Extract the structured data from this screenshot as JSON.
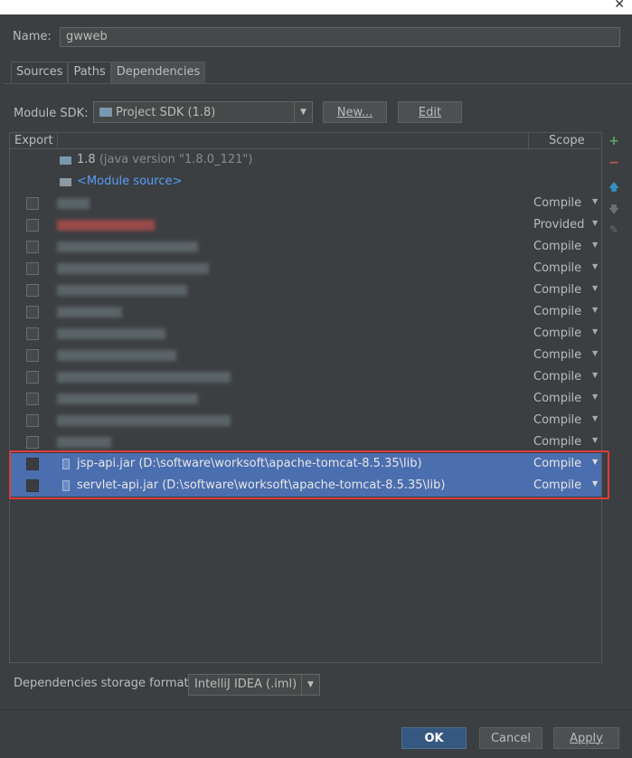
{
  "window": {
    "close_glyph": "✕"
  },
  "name": {
    "label": "Name:",
    "value": "gwweb"
  },
  "tabs": [
    {
      "label": "Sources"
    },
    {
      "label": "Paths"
    },
    {
      "label": "Dependencies",
      "active": true
    }
  ],
  "module_sdk": {
    "label": "Module SDK:",
    "value": "Project SDK (1.8)",
    "new_label": "New...",
    "edit_label": "Edit"
  },
  "table": {
    "col_export": "Export",
    "col_scope": "Scope",
    "sdk_entry": {
      "name": "1.8",
      "detail": "(java version \"1.8.0_121\")"
    },
    "module_source": "<Module source>",
    "rows": [
      {
        "scope": "Compile"
      },
      {
        "scope": "Provided"
      },
      {
        "scope": "Compile"
      },
      {
        "scope": "Compile"
      },
      {
        "scope": "Compile"
      },
      {
        "scope": "Compile"
      },
      {
        "scope": "Compile"
      },
      {
        "scope": "Compile"
      },
      {
        "scope": "Compile"
      },
      {
        "scope": "Compile"
      },
      {
        "scope": "Compile"
      },
      {
        "scope": "Compile"
      },
      {
        "name": "jsp-api.jar (D:\\software\\worksoft\\apache-tomcat-8.5.35\\lib)",
        "scope": "Compile",
        "selected": true
      },
      {
        "name": "servlet-api.jar (D:\\software\\worksoft\\apache-tomcat-8.5.35\\lib)",
        "scope": "Compile",
        "selected": true
      }
    ]
  },
  "side_toolbar": {
    "add": "+",
    "remove": "−",
    "up": "🡅",
    "down": "🡇",
    "edit": "✎"
  },
  "storage_format": {
    "label": "Dependencies storage format:",
    "value": "IntelliJ IDEA (.iml)"
  },
  "buttons": {
    "ok": "OK",
    "cancel": "Cancel",
    "apply": "Apply"
  },
  "colors": {
    "background": "#3c3f41",
    "selection": "#4b6eaf",
    "highlight_box": "#e03a3a",
    "add": "#59a869",
    "remove": "#c75450",
    "up": "#3592c4"
  }
}
